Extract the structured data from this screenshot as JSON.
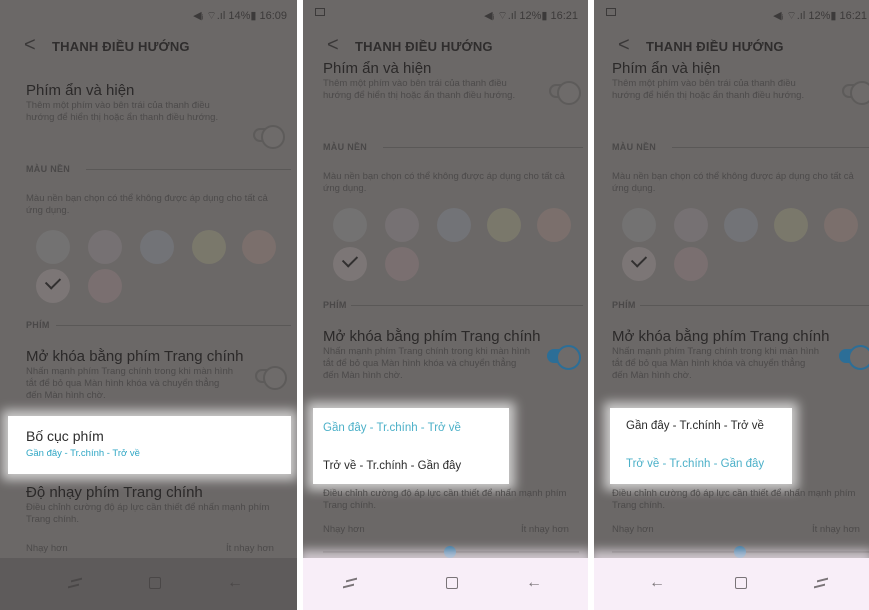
{
  "status": {
    "s1": "◀ᵢ ⌔.ıl 14%▮ 16:09",
    "s2": "◀ᵢ ⌔.ıl 12%▮ 16:21",
    "s3": "◀ᵢ ⌔.ıl 12%▮ 16:21"
  },
  "header": {
    "back_icon": "<",
    "title": "THANH ĐIỀU HƯỚNG"
  },
  "show_hide": {
    "title": "Phím ẩn và hiện",
    "desc": "Thêm một phím vào bên trái của thanh điều hướng để hiển thị hoặc ẩn thanh điều hướng."
  },
  "background": {
    "section": "MÀU NỀN",
    "desc": "Màu nền bạn chọn có thể không được áp dụng cho tất cả ứng dụng.",
    "swatches": [
      "#737272",
      "#767173",
      "#727377",
      "#7a786b",
      "#7b6f6c",
      "#7c7676",
      "#7a6f70"
    ]
  },
  "keys": {
    "section": "PHÍM",
    "unlock_title": "Mở khóa bằng phím Trang chính",
    "unlock_desc": "Nhấn mạnh phím Trang chính trong khi màn hình tắt để bỏ qua Màn hình khóa và chuyển thẳng đến Màn hình chờ."
  },
  "layout": {
    "title": "Bố cục phím",
    "value": "Gần đây - Tr.chính - Trở về",
    "option_a": "Gần đây - Tr.chính - Trở về",
    "option_b": "Trở về - Tr.chính - Gần đây"
  },
  "sensitivity": {
    "title": "Độ nhạy phím Trang chính",
    "desc": "Điều chỉnh cường độ áp lực cần thiết để nhấn mạnh phím Trang chính.",
    "more": "Nhạy hơn",
    "less": "Ít nhạy hơn",
    "level": 0.5
  },
  "accent_colors": {
    "teal": "#2ea6c4",
    "blue": "#2c6e97"
  }
}
